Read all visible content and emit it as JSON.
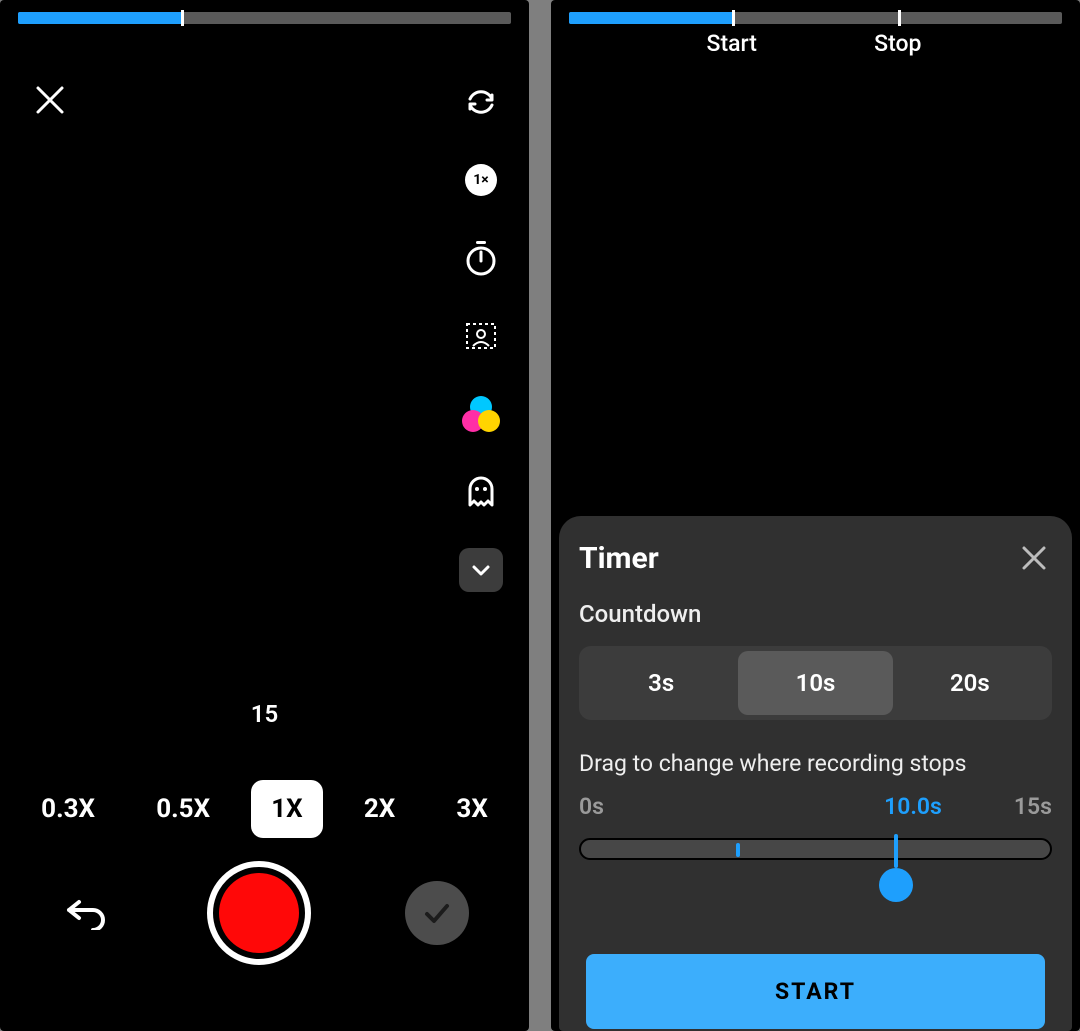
{
  "colors": {
    "accent": "#1e9ffd",
    "record": "#ff0808",
    "panel": "#303030"
  },
  "left": {
    "progress_pct": 33,
    "tools": {
      "speed_badge": "1×",
      "icons": [
        "flip-camera-icon",
        "speed-icon",
        "timer-icon",
        "greenscreen-icon",
        "filters-icon",
        "ghost-effect-icon",
        "more-tools-icon"
      ]
    },
    "duration_label": "15",
    "speeds": {
      "options": [
        "0.3X",
        "0.5X",
        "1X",
        "2X",
        "3X"
      ],
      "selected_index": 2
    }
  },
  "right": {
    "progress_pct": 33,
    "markers": {
      "start": {
        "label": "Start",
        "pct": 33
      },
      "stop": {
        "label": "Stop",
        "pct": 66.7
      }
    },
    "timer": {
      "title": "Timer",
      "countdown_label": "Countdown",
      "options": [
        "3s",
        "10s",
        "20s"
      ],
      "selected_index": 1,
      "drag_label": "Drag to change where recording stops",
      "scale": {
        "min_label": "0s",
        "current_label": "10.0s",
        "max_label": "15s",
        "current_pct": 66.7,
        "start_mark_pct": 33
      },
      "start_button": "START"
    }
  }
}
